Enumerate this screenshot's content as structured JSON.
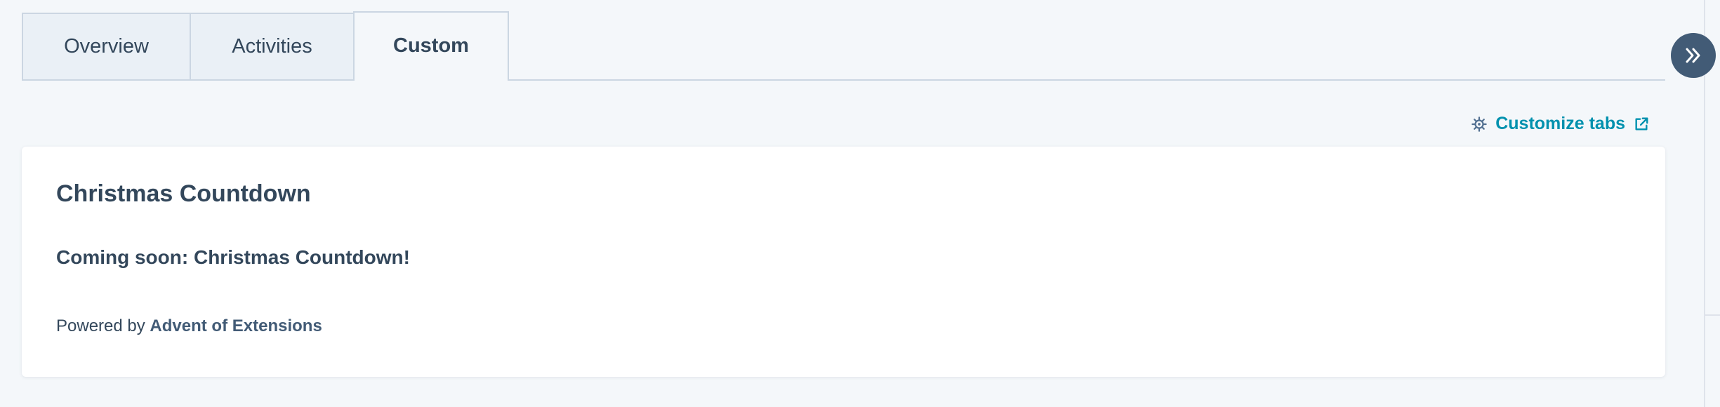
{
  "tabs": [
    {
      "label": "Overview"
    },
    {
      "label": "Activities"
    },
    {
      "label": "Custom"
    }
  ],
  "active_tab": "Custom",
  "collapse_button": {
    "icon": "double-chevron-right-icon"
  },
  "customize_tabs": {
    "label": "Customize tabs",
    "leading_icon": "gear-icon",
    "trailing_icon": "external-link-icon"
  },
  "card": {
    "title": "Christmas Countdown",
    "message": "Coming soon: Christmas Countdown!",
    "footer_prefix": "Powered by",
    "footer_link": "Advent of Extensions"
  },
  "colors": {
    "page_background": "#f4f7fa",
    "text": "#33475b",
    "link": "#0091ae",
    "brand_link": "#425b76",
    "collapse_button": "#425b76",
    "tab_border": "#cbd6e2",
    "inactive_tab": "#eaf0f6"
  }
}
